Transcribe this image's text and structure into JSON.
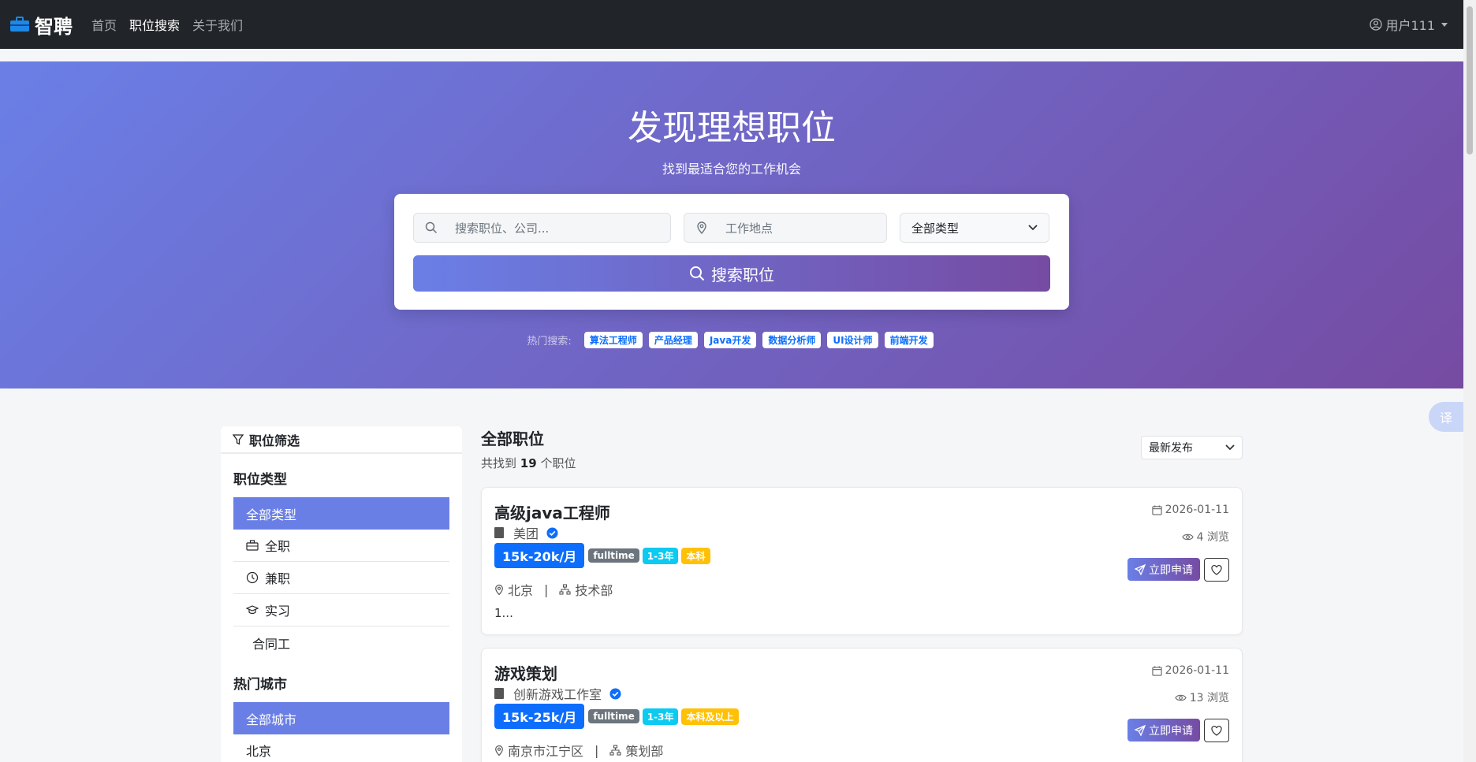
{
  "navbar": {
    "brand": "智聘",
    "links": [
      "首页",
      "职位搜索",
      "关于我们"
    ],
    "user": "用户111"
  },
  "hero": {
    "title": "发现理想职位",
    "subtitle": "找到最适合您的工作机会",
    "keyword_placeholder": "搜索职位、公司...",
    "location_placeholder": "工作地点",
    "type_select": "全部类型",
    "search_button": "搜索职位",
    "hot_label": "热门搜索:",
    "hot_tags": [
      "算法工程师",
      "产品经理",
      "Java开发",
      "数据分析师",
      "UI设计师",
      "前端开发"
    ]
  },
  "sidebar": {
    "header": "职位筛选",
    "job_type_title": "职位类型",
    "job_types": [
      "全部类型",
      "全职",
      "兼职",
      "实习",
      "合同工"
    ],
    "city_title": "热门城市",
    "cities": [
      "全部城市",
      "北京"
    ]
  },
  "main": {
    "title": "全部职位",
    "count_prefix": "共找到",
    "count": "19",
    "count_suffix": "个职位",
    "sort": "最新发布",
    "apply_label": "立即申请",
    "jobs": [
      {
        "title": "高级java工程师",
        "company": "美团",
        "salary": "15k-20k/月",
        "tags": [
          "fulltime",
          "1-3年",
          "本科"
        ],
        "location": "北京",
        "department": "技术部",
        "desc": "1...",
        "date": "2026-01-11",
        "views": "4 浏览"
      },
      {
        "title": "游戏策划",
        "company": "创新游戏工作室",
        "salary": "15k-25k/月",
        "tags": [
          "fulltime",
          "1-3年",
          "本科及以上"
        ],
        "location": "南京市江宁区",
        "department": "策划部",
        "date": "2026-01-11",
        "views": "13 浏览"
      }
    ]
  },
  "widget": {
    "translate": "译"
  },
  "colors": {
    "accent": "#6a7fe6",
    "accent_end": "#764ba2",
    "primary": "#0d6efd",
    "navbar": "#212529"
  }
}
